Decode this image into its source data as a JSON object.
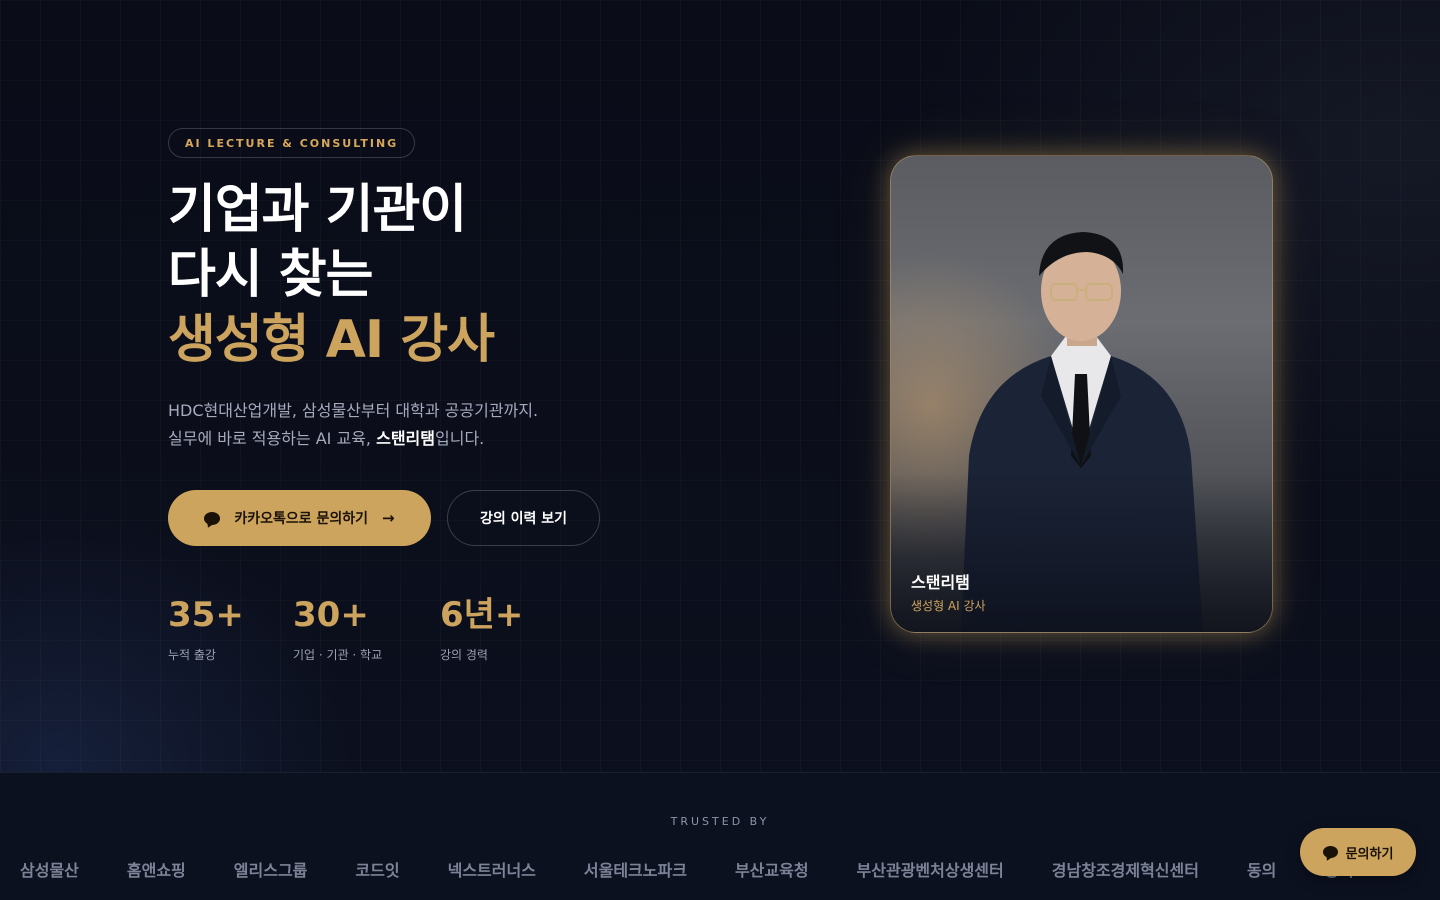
{
  "hero": {
    "badge": "AI LECTURE & CONSULTING",
    "headline": {
      "line1": "기업과 기관이",
      "line2": "다시 찾는",
      "line3": "생성형 AI 강사"
    },
    "description": {
      "line1": "HDC현대산업개발, 삼성물산부터 대학과 공공기관까지.",
      "line2_before": "실무에 바로 적용하는 AI 교육, ",
      "line2_strong": "스탠리탬",
      "line2_after": "입니다."
    },
    "primary_button": {
      "label": "카카오톡으로 문의하기",
      "icon": "chat-bubble-icon",
      "trailing_icon": "arrow-right-icon"
    },
    "secondary_button": {
      "label": "강의 이력 보기"
    },
    "stats": [
      {
        "value": "35+",
        "label": "누적 출강"
      },
      {
        "value": "30+",
        "label": "기업 · 기관 · 학교"
      },
      {
        "value": "6년+",
        "label": "강의 경력"
      }
    ]
  },
  "profile_card": {
    "name": "스탠리탬",
    "role": "생성형 AI 강사"
  },
  "trusted": {
    "label": "TRUSTED BY",
    "logos": [
      "삼성물산",
      "홈앤쇼핑",
      "엘리스그룹",
      "코드잇",
      "넥스트러너스",
      "서울테크노파크",
      "부산교육청",
      "부산관광벤처상생센터",
      "경남창조경제혁신센터",
      "동의",
      "동의"
    ]
  },
  "floating_button": {
    "label": "문의하기",
    "icon": "chat-bubble-icon"
  },
  "colors": {
    "background": "#0a0d18",
    "accent_gold": "#cda45e",
    "muted_text": "#a4abbd"
  }
}
